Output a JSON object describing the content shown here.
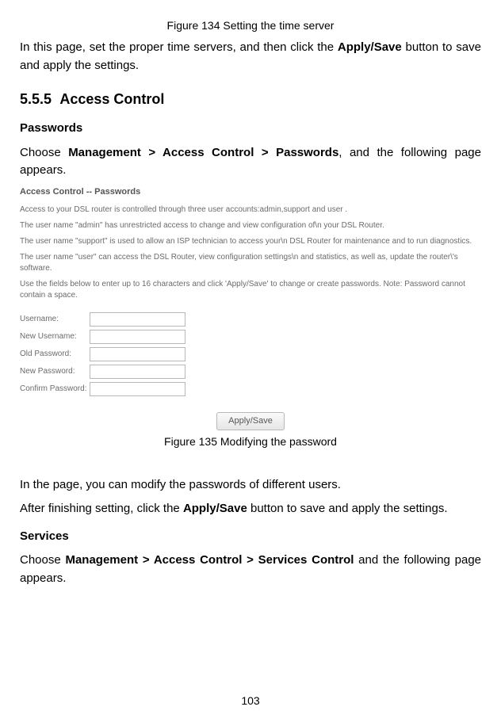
{
  "fig134_caption": "Figure 134 Setting the time server",
  "intro_para": {
    "pre": "In this page, set the proper time servers, and then click the ",
    "bold": "Apply/Save",
    "post": " button to save and apply the settings."
  },
  "section": {
    "num": "5.5.5",
    "title": "Access Control"
  },
  "passwords": {
    "heading": "Passwords",
    "para": {
      "pre": "Choose ",
      "bold": "Management > Access Control > Passwords",
      "post": ", and the following page appears."
    }
  },
  "panel": {
    "title": "Access Control -- Passwords",
    "p1": "Access to your DSL router is controlled through three user accounts:admin,support and user .",
    "p2": "The user name \"admin\" has unrestricted access to change and view configuration of\\n your DSL Router.",
    "p3": "The user name \"support\" is used to allow an ISP technician to access your\\n DSL Router for maintenance and to run diagnostics.",
    "p4": "The user name \"user\" can access the DSL Router, view configuration settings\\n and statistics, as well as, update the router\\'s software.",
    "p5": "Use the fields below to enter up to 16 characters and click 'Apply/Save' to change or create passwords. Note: Password cannot contain a space.",
    "fields": {
      "username": "Username:",
      "new_username": "New Username:",
      "old_password": "Old Password:",
      "new_password": "New Password:",
      "confirm_password": "Confirm Password:"
    },
    "apply_label": "Apply/Save"
  },
  "fig135_caption": "Figure 135 Modifying the password",
  "after_fig": {
    "p1": "In the page, you can modify the passwords of different users.",
    "p2": {
      "pre": "After finishing setting, click the ",
      "bold": "Apply/Save",
      "post": " button to save and apply the settings."
    }
  },
  "services": {
    "heading": "Services",
    "para": {
      "pre": "Choose ",
      "bold": "Management > Access Control > Services Control",
      "post": " and the following page appears."
    }
  },
  "page_number": "103"
}
